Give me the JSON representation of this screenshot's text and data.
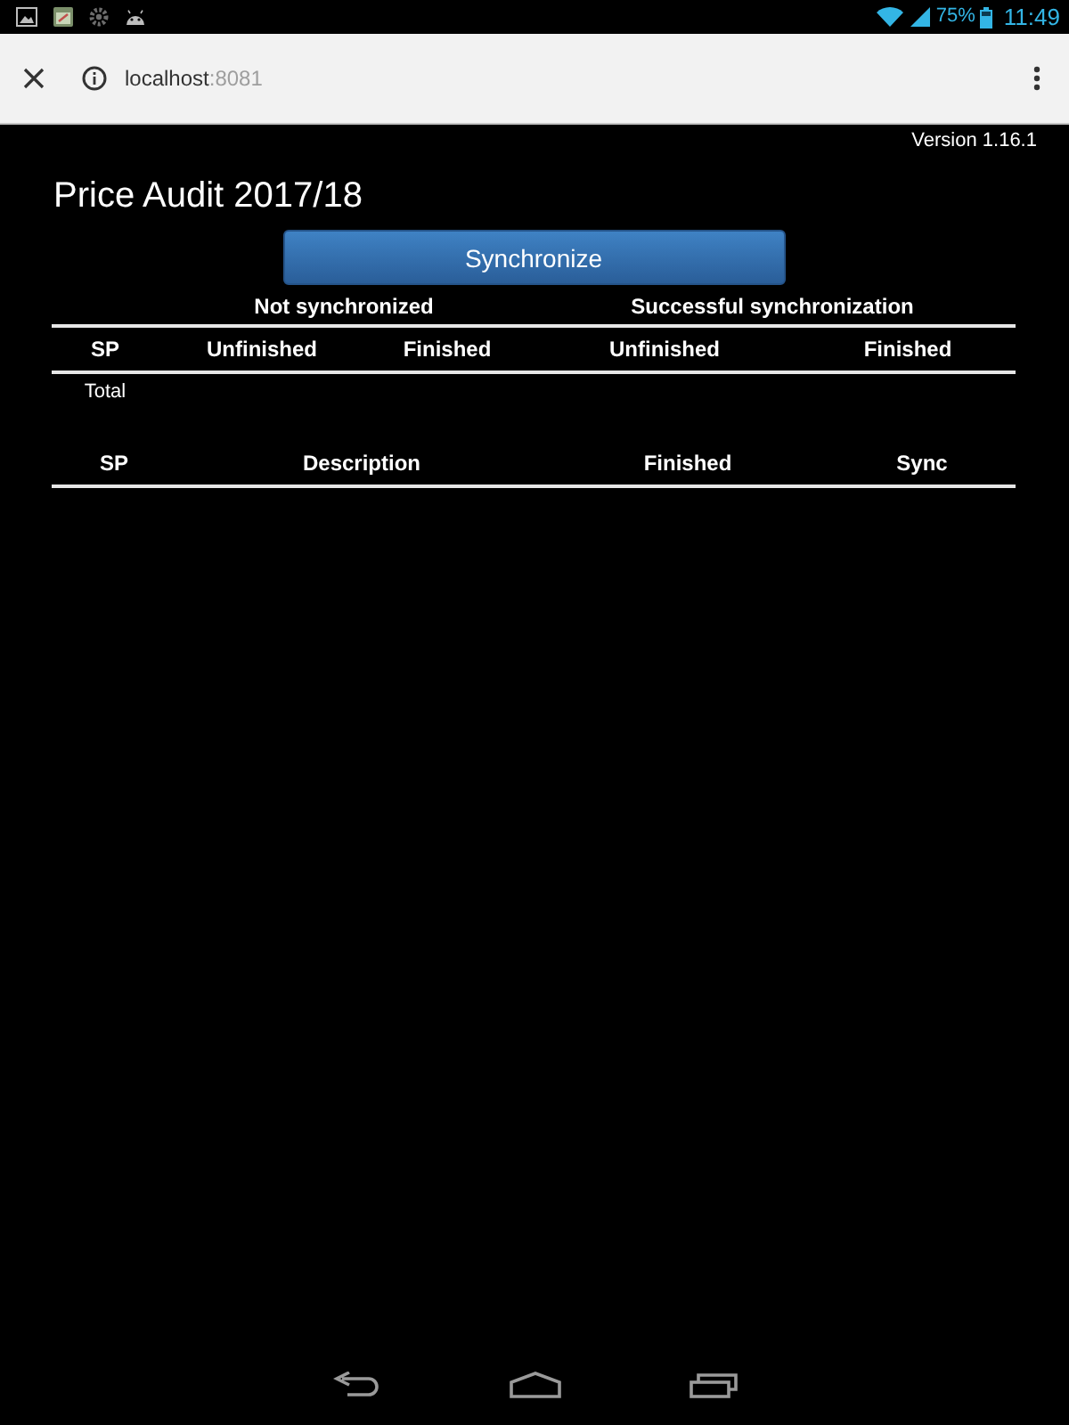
{
  "status_bar": {
    "battery": "75%",
    "time": "11:49"
  },
  "browser_toolbar": {
    "url_host": "localhost",
    "url_port": ":8081"
  },
  "page": {
    "version": "Version 1.16.1",
    "title": "Price Audit 2017/18",
    "sync_button": "Synchronize"
  },
  "summary_table": {
    "column_groups": [
      "Not synchronized",
      "Successful synchronization"
    ],
    "columns": [
      "SP",
      "Unfinished",
      "Finished",
      "Unfinished",
      "Finished"
    ],
    "rows": [
      [
        "Total"
      ]
    ]
  },
  "detail_table": {
    "columns": [
      "SP",
      "Description",
      "Finished",
      "Sync"
    ]
  }
}
